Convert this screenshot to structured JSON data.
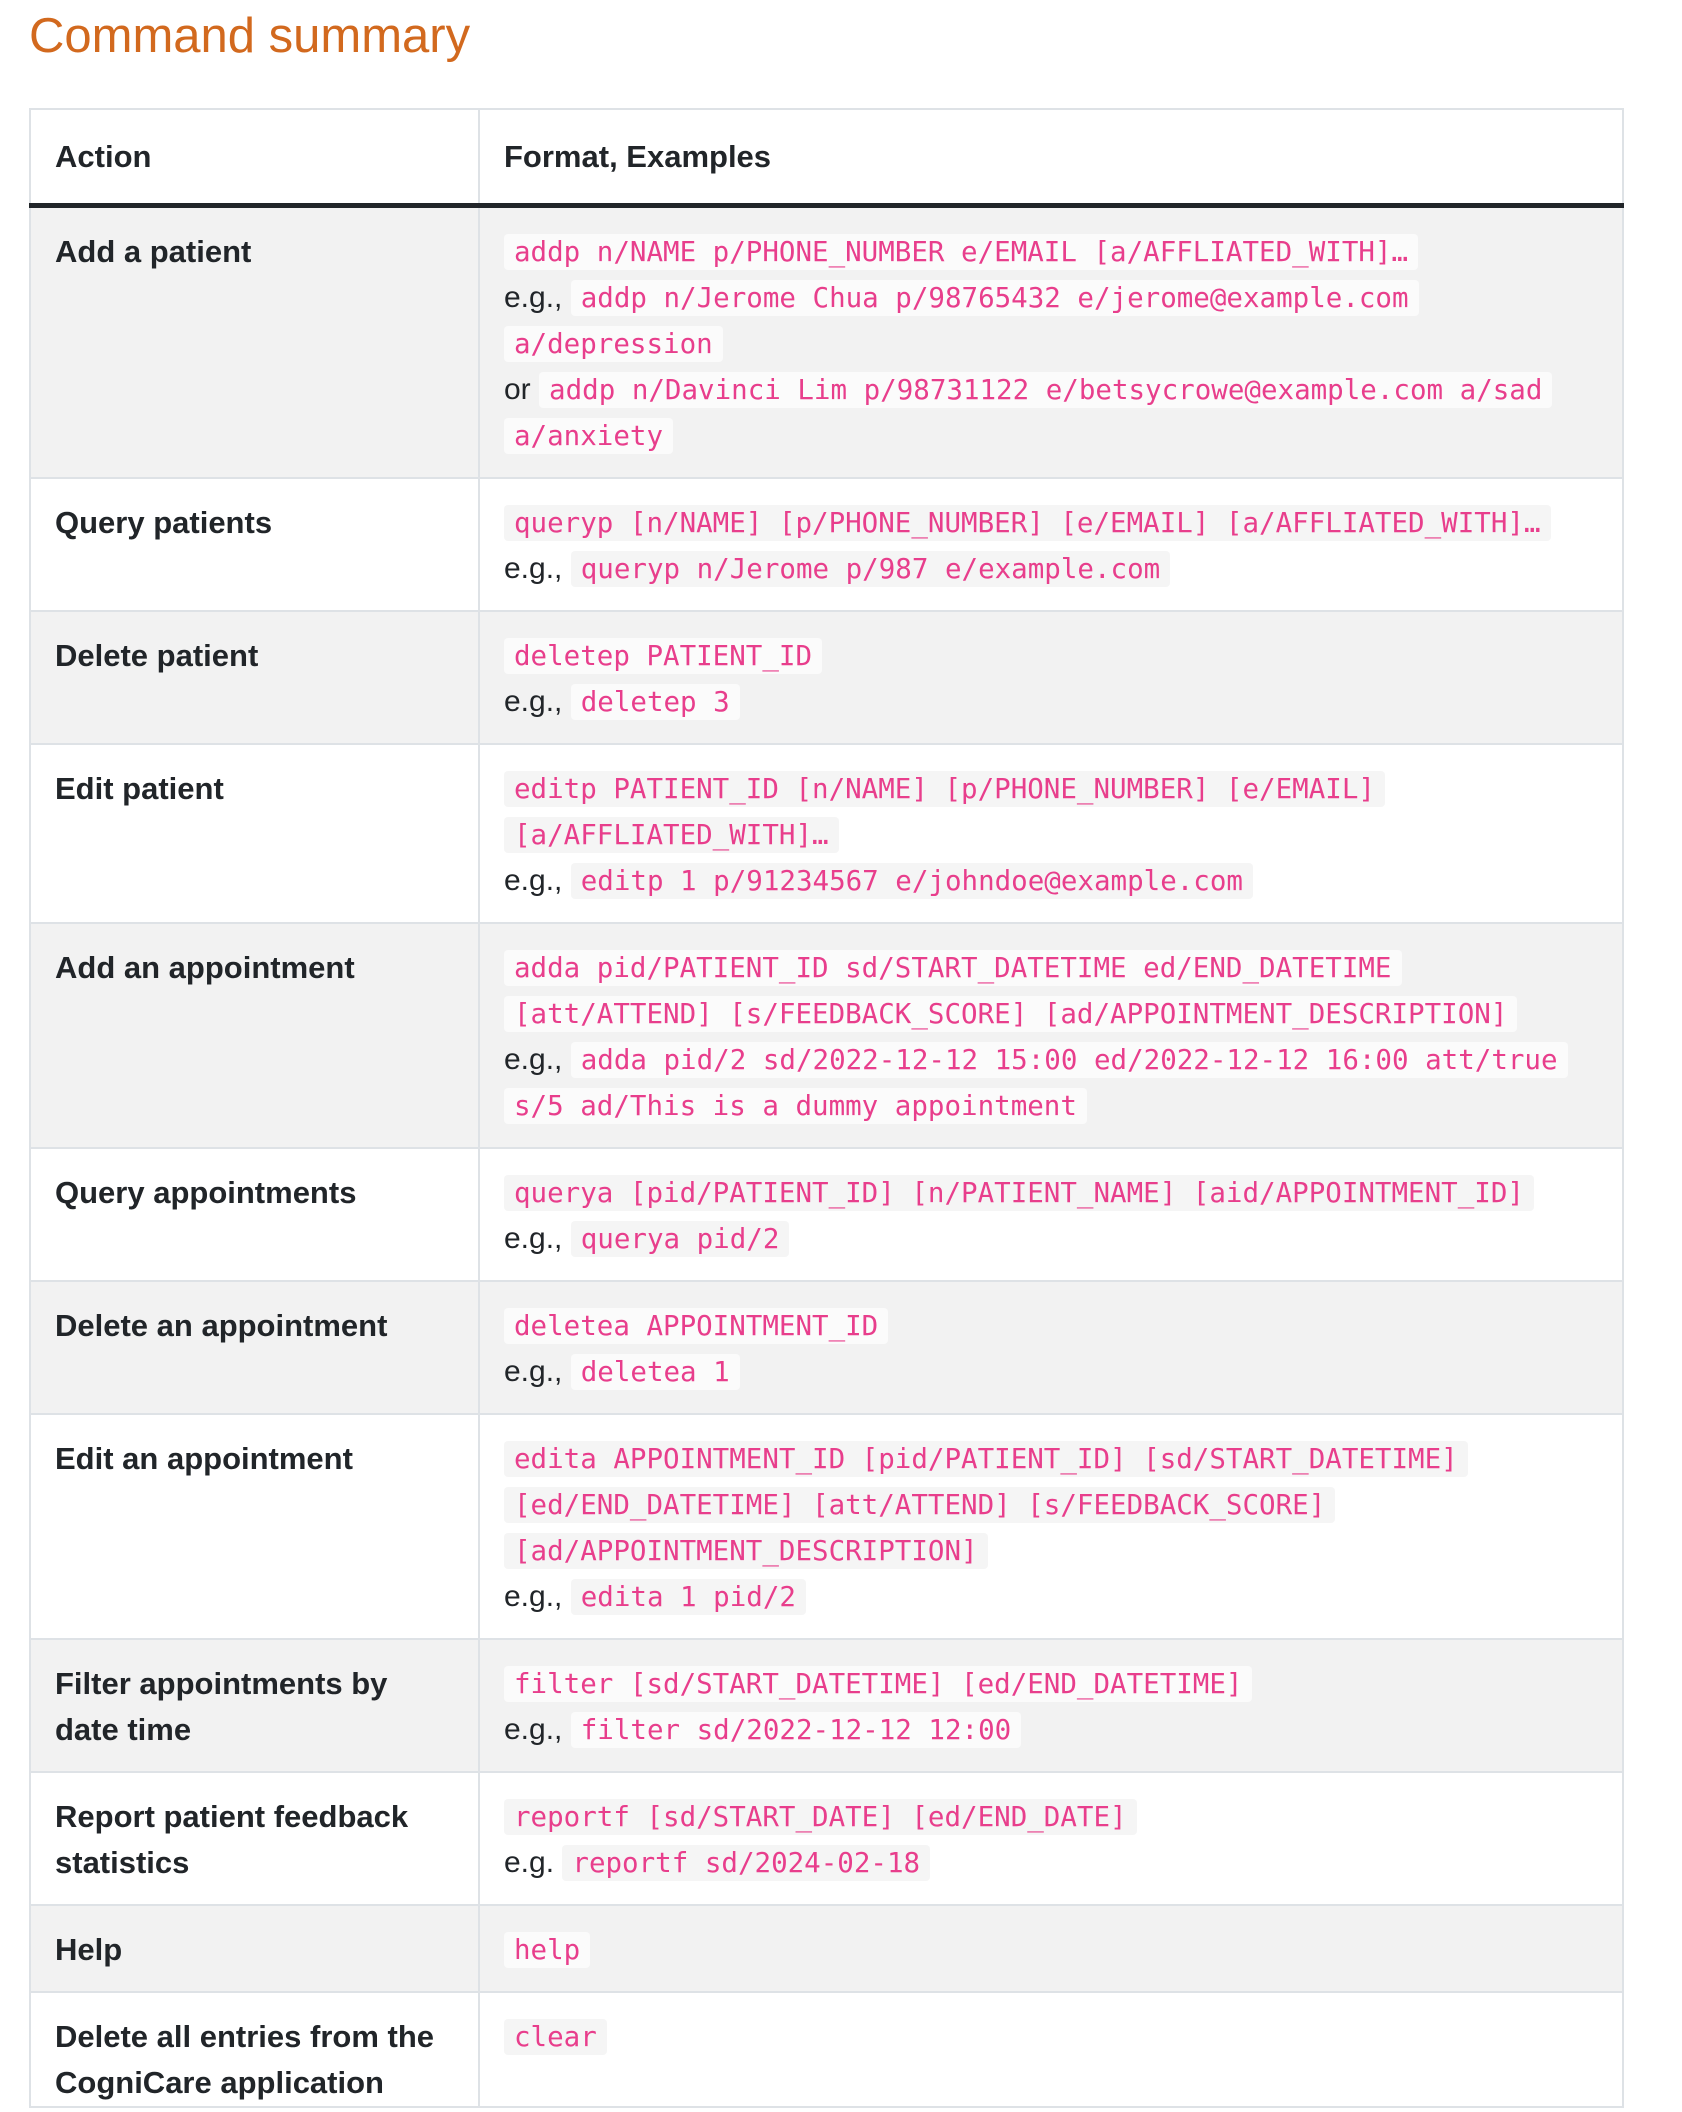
{
  "title": "Command summary",
  "table": {
    "headers": [
      "Action",
      "Format, Examples"
    ],
    "rows": [
      {
        "action": "Add a patient",
        "format": "addp n/NAME p/PHONE_NUMBER e/EMAIL [a/AFFLIATED_WITH]…",
        "examples": [
          {
            "prefix": "e.g.,",
            "code": "addp n/Jerome Chua p/98765432 e/jerome@example.com a/depression"
          },
          {
            "prefix": "or",
            "code": "addp n/Davinci Lim p/98731122 e/betsycrowe@example.com a/sad a/anxiety"
          }
        ]
      },
      {
        "action": "Query patients",
        "format": "queryp [n/NAME] [p/PHONE_NUMBER] [e/EMAIL] [a/AFFLIATED_WITH]…",
        "examples": [
          {
            "prefix": "e.g.,",
            "code": "queryp n/Jerome p/987 e/example.com"
          }
        ]
      },
      {
        "action": "Delete patient",
        "format": "deletep PATIENT_ID",
        "examples": [
          {
            "prefix": "e.g.,",
            "code": "deletep 3"
          }
        ]
      },
      {
        "action": "Edit patient",
        "format": "editp PATIENT_ID [n/NAME] [p/PHONE_NUMBER] [e/EMAIL] [a/AFFLIATED_WITH]…",
        "examples": [
          {
            "prefix": "e.g.,",
            "code": "editp 1 p/91234567 e/johndoe@example.com"
          }
        ]
      },
      {
        "action": "Add an appointment",
        "format": "adda pid/PATIENT_ID sd/START_DATETIME ed/END_DATETIME [att/ATTEND] [s/FEEDBACK_SCORE] [ad/APPOINTMENT_DESCRIPTION]",
        "examples": [
          {
            "prefix": "e.g.,",
            "code": "adda pid/2 sd/2022-12-12 15:00 ed/2022-12-12 16:00 att/true s/5 ad/This is a dummy appointment"
          }
        ]
      },
      {
        "action": "Query appointments",
        "format": "querya [pid/PATIENT_ID] [n/PATIENT_NAME] [aid/APPOINTMENT_ID]",
        "examples": [
          {
            "prefix": "e.g.,",
            "code": "querya pid/2"
          }
        ]
      },
      {
        "action": "Delete an appointment",
        "format": "deletea APPOINTMENT_ID",
        "examples": [
          {
            "prefix": "e.g.,",
            "code": "deletea 1"
          }
        ]
      },
      {
        "action": "Edit an appointment",
        "format": "edita APPOINTMENT_ID [pid/PATIENT_ID] [sd/START_DATETIME] [ed/END_DATETIME] [att/ATTEND] [s/FEEDBACK_SCORE] [ad/APPOINTMENT_DESCRIPTION]",
        "examples": [
          {
            "prefix": "e.g.,",
            "code": "edita 1 pid/2"
          }
        ]
      },
      {
        "action": "Filter appointments by date time",
        "format": "filter [sd/START_DATETIME] [ed/END_DATETIME]",
        "examples": [
          {
            "prefix": "e.g.,",
            "code": "filter sd/2022-12-12 12:00"
          }
        ]
      },
      {
        "action": "Report patient feedback statistics",
        "format": "reportf [sd/START_DATE] [ed/END_DATE]",
        "examples": [
          {
            "prefix": "e.g.",
            "code": "reportf sd/2024-02-18"
          }
        ]
      },
      {
        "action": "Help",
        "format": "help",
        "examples": []
      },
      {
        "action": "Delete all entries from the CogniCare application",
        "format": "clear",
        "examples": []
      }
    ]
  }
}
